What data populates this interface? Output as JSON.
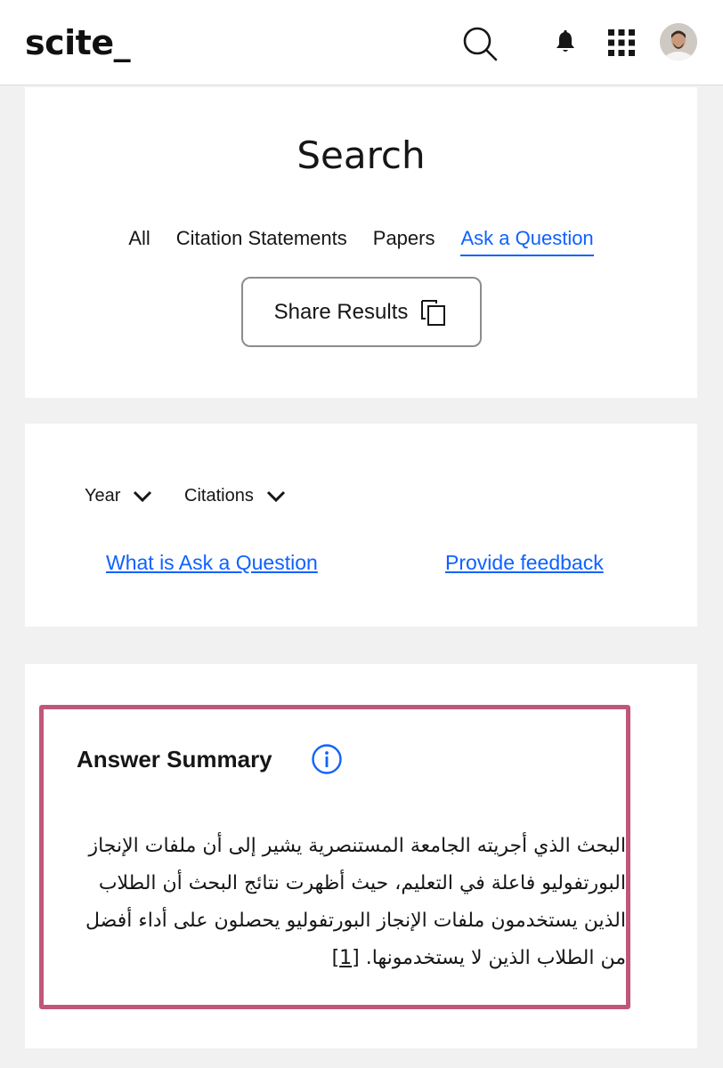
{
  "header": {
    "logo": "scite_"
  },
  "search_card": {
    "title": "Search",
    "tabs": [
      {
        "label": "All",
        "active": false
      },
      {
        "label": "Citation Statements",
        "active": false
      },
      {
        "label": "Papers",
        "active": false
      },
      {
        "label": "Ask a Question",
        "active": true
      }
    ],
    "share_label": "Share Results"
  },
  "filters": {
    "year_label": "Year",
    "citations_label": "Citations",
    "what_link": "What is Ask a Question",
    "feedback_link": "Provide feedback"
  },
  "answer": {
    "title": "Answer Summary",
    "text": "البحث الذي أجريته الجامعة المستنصرية يشير إلى أن ملفات الإنجاز البورتفوليو فاعلة في التعليم، حيث أظهرت نتائج البحث أن الطلاب الذين يستخدمون ملفات الإنجاز البورتفوليو يحصلون على أداء أفضل من الطلاب الذين لا يستخدمونها.",
    "ref": "[1]"
  },
  "colors": {
    "accent": "#0f62fe",
    "highlight_border": "#c0567a"
  },
  "icons": [
    "search-icon",
    "bell-icon",
    "app-grid-icon",
    "copy-icon",
    "chevron-down-icon",
    "info-icon"
  ]
}
